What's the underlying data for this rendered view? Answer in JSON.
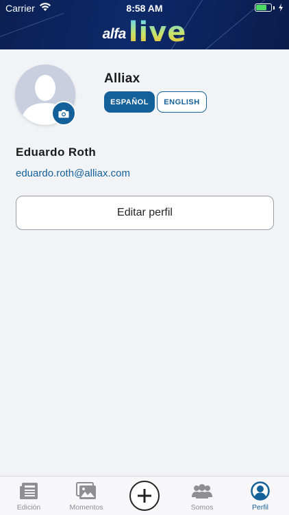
{
  "status_bar": {
    "carrier": "Carrier",
    "time": "8:58 AM"
  },
  "header": {
    "logo_alfa": "alfa",
    "logo_live": "live"
  },
  "profile": {
    "company": "Alliax",
    "name": "Eduardo Roth",
    "email": "eduardo.roth@alliax.com",
    "languages": [
      {
        "label": "ESPAÑOL",
        "selected": true
      },
      {
        "label": "ENGLISH",
        "selected": false
      }
    ],
    "edit_label": "Editar perfil"
  },
  "tabbar": {
    "tabs": [
      {
        "label": "Edición",
        "icon": "newspaper-icon",
        "active": false
      },
      {
        "label": "Momentos",
        "icon": "photos-icon",
        "active": false
      },
      {
        "label": "",
        "icon": "plus-circle-icon",
        "active": false
      },
      {
        "label": "Somos",
        "icon": "group-icon",
        "active": false
      },
      {
        "label": "Perfil",
        "icon": "profile-icon",
        "active": true
      }
    ]
  },
  "colors": {
    "accent": "#14609a",
    "header_bg": "#0e2a6a",
    "page_bg": "#f2f3f7",
    "battery": "#4cd964"
  }
}
